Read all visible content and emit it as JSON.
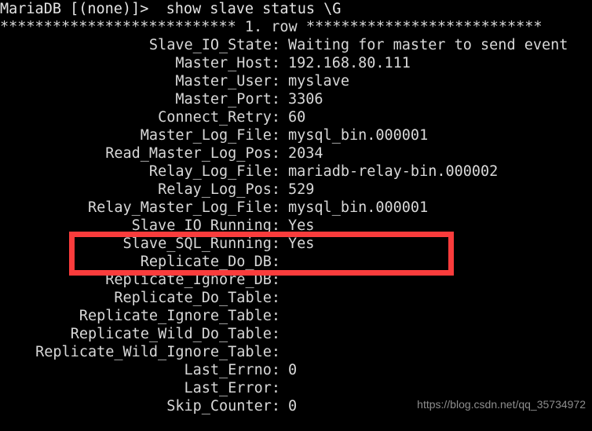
{
  "terminal": {
    "background_color": "#000000",
    "text_color": "#d8d8d8",
    "prompt_line": "MariaDB [(none)]>  show slave status \\G",
    "separator_line": "*************************** 1. row ***************************",
    "rows": [
      {
        "label": "Slave_IO_State:",
        "value": "Waiting for master to send event"
      },
      {
        "label": "Master_Host:",
        "value": "192.168.80.111"
      },
      {
        "label": "Master_User:",
        "value": "myslave"
      },
      {
        "label": "Master_Port:",
        "value": "3306"
      },
      {
        "label": "Connect_Retry:",
        "value": "60"
      },
      {
        "label": "Master_Log_File:",
        "value": "mysql_bin.000001"
      },
      {
        "label": "Read_Master_Log_Pos:",
        "value": "2034"
      },
      {
        "label": "Relay_Log_File:",
        "value": "mariadb-relay-bin.000002"
      },
      {
        "label": "Relay_Log_Pos:",
        "value": "529"
      },
      {
        "label": "Relay_Master_Log_File:",
        "value": "mysql_bin.000001"
      },
      {
        "label": "Slave_IO_Running:",
        "value": "Yes"
      },
      {
        "label": "Slave_SQL_Running:",
        "value": "Yes"
      },
      {
        "label": "Replicate_Do_DB:",
        "value": ""
      },
      {
        "label": "Replicate_Ignore_DB:",
        "value": ""
      },
      {
        "label": "Replicate_Do_Table:",
        "value": ""
      },
      {
        "label": "Replicate_Ignore_Table:",
        "value": ""
      },
      {
        "label": "Replicate_Wild_Do_Table:",
        "value": ""
      },
      {
        "label": "Replicate_Wild_Ignore_Table:",
        "value": ""
      },
      {
        "label": "Last_Errno:",
        "value": "0"
      },
      {
        "label": "Last_Error:",
        "value": ""
      },
      {
        "label": "Skip_Counter:",
        "value": "0"
      }
    ]
  },
  "annotation": {
    "color": "#fa3c3c",
    "target_rows": [
      "Slave_IO_Running",
      "Slave_SQL_Running"
    ]
  },
  "watermark": {
    "text": "https://blog.csdn.net/qq_35734972",
    "color": "#8d8d8d"
  }
}
